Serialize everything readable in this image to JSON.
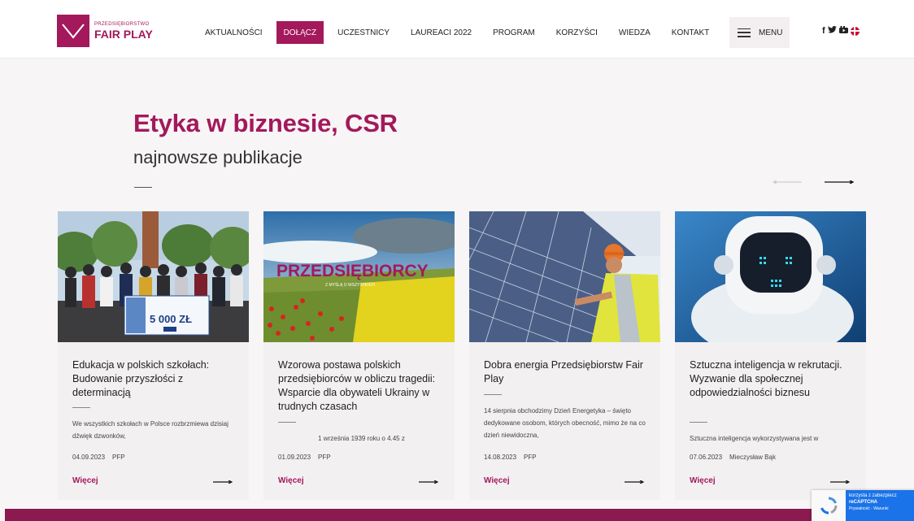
{
  "header": {
    "logo_small": "PRZEDSIĘBIORSTWO",
    "logo_big": "FAIR PLAY",
    "nav": [
      {
        "label": "AKTUALNOŚCI",
        "active": false
      },
      {
        "label": "DOŁĄCZ",
        "active": true
      },
      {
        "label": "UCZESTNICY",
        "active": false
      },
      {
        "label": "LAUREACI 2022",
        "active": false
      },
      {
        "label": "PROGRAM",
        "active": false
      },
      {
        "label": "KORZYŚCI",
        "active": false
      },
      {
        "label": "WIEDZA",
        "active": false
      },
      {
        "label": "KONTAKT",
        "active": false
      }
    ],
    "menu_label": "MENU",
    "social": {
      "facebook": "f",
      "twitter": "🐦",
      "youtube": "▶"
    }
  },
  "section": {
    "title": "Etyka w biznesie, CSR",
    "subtitle": "najnowsze publikacje"
  },
  "cards": [
    {
      "title": "Edukacja w polskich szkołach: Budowanie przyszłości z determinacją",
      "excerpt": "We wszystkich szkołach w Polsce rozbrzmiewa dzisiaj dźwięk dzwonków,",
      "date": "04.09.2023",
      "author": "PFP",
      "more": "Więcej",
      "image_text": "5 000 ZŁ"
    },
    {
      "title": "Wzorowa postawa polskich przedsiębiorców w obliczu tragedii: Wsparcie dla obywateli Ukrainy w trudnych czasach",
      "excerpt": "1 września 1939 roku o 4.45 z",
      "date": "01.09.2023",
      "author": "PFP",
      "more": "Więcej",
      "image_text": "PRZEDSIĘBIORCY",
      "image_subtext": "Z MYŚLĄ O WSZYSTKICH"
    },
    {
      "title": "Dobra energia Przedsiębiorstw Fair Play",
      "excerpt": "14 sierpnia obchodzimy Dzień Energetyka – święto dedykowane osobom, których obecność, mimo że na co dzień niewidoczna,",
      "date": "14.08.2023",
      "author": "PFP",
      "more": "Więcej"
    },
    {
      "title": "Sztuczna inteligencja w rekrutacji. Wyzwanie dla społecznej odpowiedzialności biznesu",
      "excerpt": "Sztuczna inteligencja wykorzystywana jest w",
      "date": "07.06.2023",
      "author": "Mieczysław Bąk",
      "more": "Więcej"
    }
  ],
  "recaptcha": {
    "line1": "korzysta z zabezpiecz",
    "line2": "reCAPTCHA",
    "line3": "Prywatność - Warunki"
  },
  "colors": {
    "brand": "#a3195b",
    "band": "#8a1a4f"
  }
}
